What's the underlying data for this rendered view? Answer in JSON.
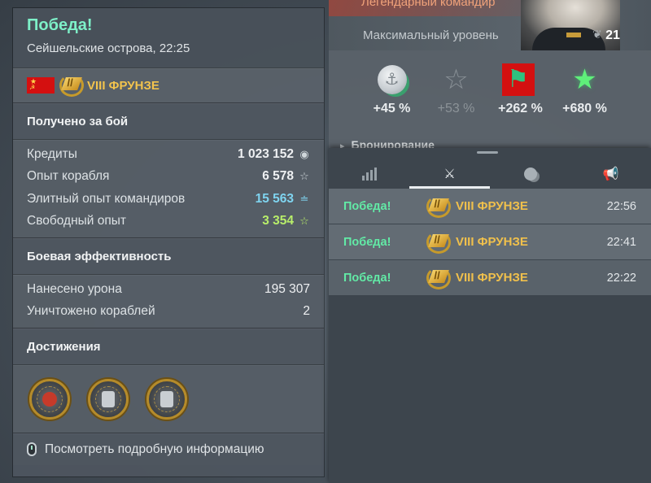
{
  "result": {
    "title": "Победа!",
    "map_time": "Сейшельские острова, 22:25",
    "ship_name": "VIII ФРУНЗЕ",
    "earned_header": "Получено за бой",
    "earned": [
      {
        "label": "Кредиты",
        "value": "1 023 152",
        "icon": "credits-icon",
        "glyph": "◉",
        "style": ""
      },
      {
        "label": "Опыт корабля",
        "value": "6 578",
        "icon": "xp-star-icon",
        "glyph": "☆",
        "style": ""
      },
      {
        "label": "Элитный опыт командиров",
        "value": "15 563",
        "icon": "elite-commander-xp-icon",
        "glyph": "≐",
        "style": "cyan"
      },
      {
        "label": "Свободный опыт",
        "value": "3 354",
        "icon": "free-xp-icon",
        "glyph": "☆",
        "style": "lime"
      }
    ],
    "efficiency_header": "Боевая эффективность",
    "efficiency": [
      {
        "label": "Нанесено урона",
        "value": "195 307"
      },
      {
        "label": "Уничтожено кораблей",
        "value": "2"
      }
    ],
    "achievements_header": "Достижения",
    "achievements": [
      "achievement-medal-1",
      "achievement-medal-2",
      "achievement-medal-3"
    ],
    "details_link": "Посмотреть подробную информацию"
  },
  "commander": {
    "title": "Легендарный командир",
    "level_text": "Максимальный уровень",
    "level": "21"
  },
  "bonuses": [
    {
      "icon": "credits-bonus-icon",
      "value": "+45 %",
      "active": true
    },
    {
      "icon": "ship-xp-bonus-icon",
      "value": "+53 %",
      "active": false
    },
    {
      "icon": "commander-xp-bonus-icon",
      "value": "+262 %",
      "active": true
    },
    {
      "icon": "free-xp-bonus-icon",
      "value": "+680 %",
      "active": true
    }
  ],
  "armor_peek": "Бронирование",
  "tabs": [
    "stats-tab",
    "battles-tab",
    "economy-tab",
    "announcements-tab"
  ],
  "battles": [
    {
      "result": "Победа!",
      "ship": "VIII ФРУНЗЕ",
      "time": "22:56"
    },
    {
      "result": "Победа!",
      "ship": "VIII ФРУНЗЕ",
      "time": "22:41"
    },
    {
      "result": "Победа!",
      "ship": "VIII ФРУНЗЕ",
      "time": "22:22"
    }
  ],
  "colors": {
    "victory": "#62eaa6",
    "ship_name": "#f0c04c",
    "elite_xp": "#7fd4f0",
    "free_xp": "#b8ee6a"
  }
}
